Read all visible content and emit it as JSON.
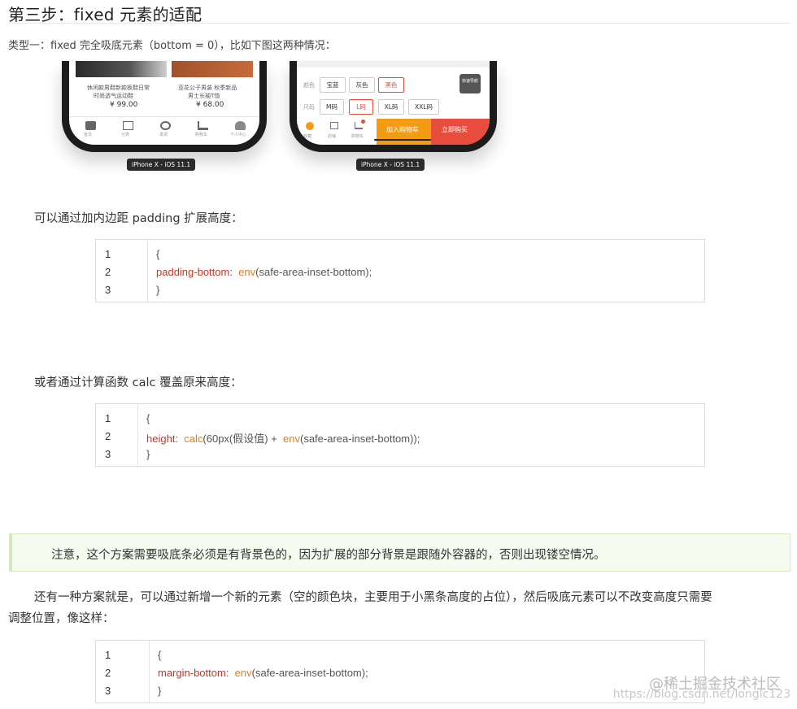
{
  "heading": "第三步：fixed 元素的适配",
  "subheading": "类型一：fixed 完全吸底元素（bottom = 0），比如下图这两种情况：",
  "figure": {
    "left_phone": {
      "product1_title_line1": "休闲款男鞋新款板鞋日常",
      "product1_title_line2": "时尚透气运动鞋",
      "product1_price": "¥ 99.00",
      "product2_title_line1": "亚花公子男装 秋季新品",
      "product2_title_line2": "男士长袖T恤",
      "product2_price": "¥ 68.00",
      "tabs": [
        "首页",
        "分类",
        "发现",
        "购物车",
        "个人中心"
      ],
      "label": "iPhone X - iOS 11.1"
    },
    "right_phone": {
      "color_label": "颜色",
      "colors": [
        "宝蓝",
        "灰色",
        "黑色"
      ],
      "size_label": "尺码",
      "sizes": [
        "M码",
        "L码",
        "XL码",
        "XXL码"
      ],
      "quick_nav": "快速导航",
      "bottom_icons": [
        "收藏",
        "店铺",
        "购物车"
      ],
      "add_cart": "加入购物车",
      "buy_now": "立即购买",
      "label": "iPhone X - iOS 11.1"
    }
  },
  "para1": "可以通过加内边距 padding 扩展高度：",
  "code1": {
    "lines": [
      "1",
      "2",
      "3"
    ],
    "open": "{",
    "prop": "padding-bottom",
    "colon": ":",
    "fn": "env",
    "arg": "(safe-area-inset-bottom);",
    "close": "}"
  },
  "para2": "或者通过计算函数 calc 覆盖原来高度：",
  "code2": {
    "lines": [
      "1",
      "2",
      "3"
    ],
    "open": "{",
    "prop": "height",
    "colon": ":",
    "fn1": "calc",
    "arg1": "(60px(假设值) + ",
    "fn2": "env",
    "arg2": "(safe-area-inset-bottom));",
    "close": "}"
  },
  "note": "注意，这个方案需要吸底条必须是有背景色的，因为扩展的部分背景是跟随外容器的，否则出现镂空情况。",
  "para3_line1": "还有一种方案就是，可以通过新增一个新的元素（空的颜色块，主要用于小黑条高度的占位），然后吸底元素可以不改变高度只需要",
  "para3_line2": "调整位置，像这样：",
  "code3": {
    "lines": [
      "1",
      "2",
      "3"
    ],
    "open": "{",
    "prop": "margin-bottom",
    "colon": ":",
    "fn": "env",
    "arg": "(safe-area-inset-bottom);",
    "close": "}"
  },
  "watermark": "@稀土掘金技术社区",
  "watermark_url": "https://blog.csdn.net/longlc123",
  "colors": {
    "accent_orange": "#f39c12",
    "accent_red": "#e74c3c",
    "prop_red": "#c0392b",
    "fn_orange": "#e67e22"
  }
}
